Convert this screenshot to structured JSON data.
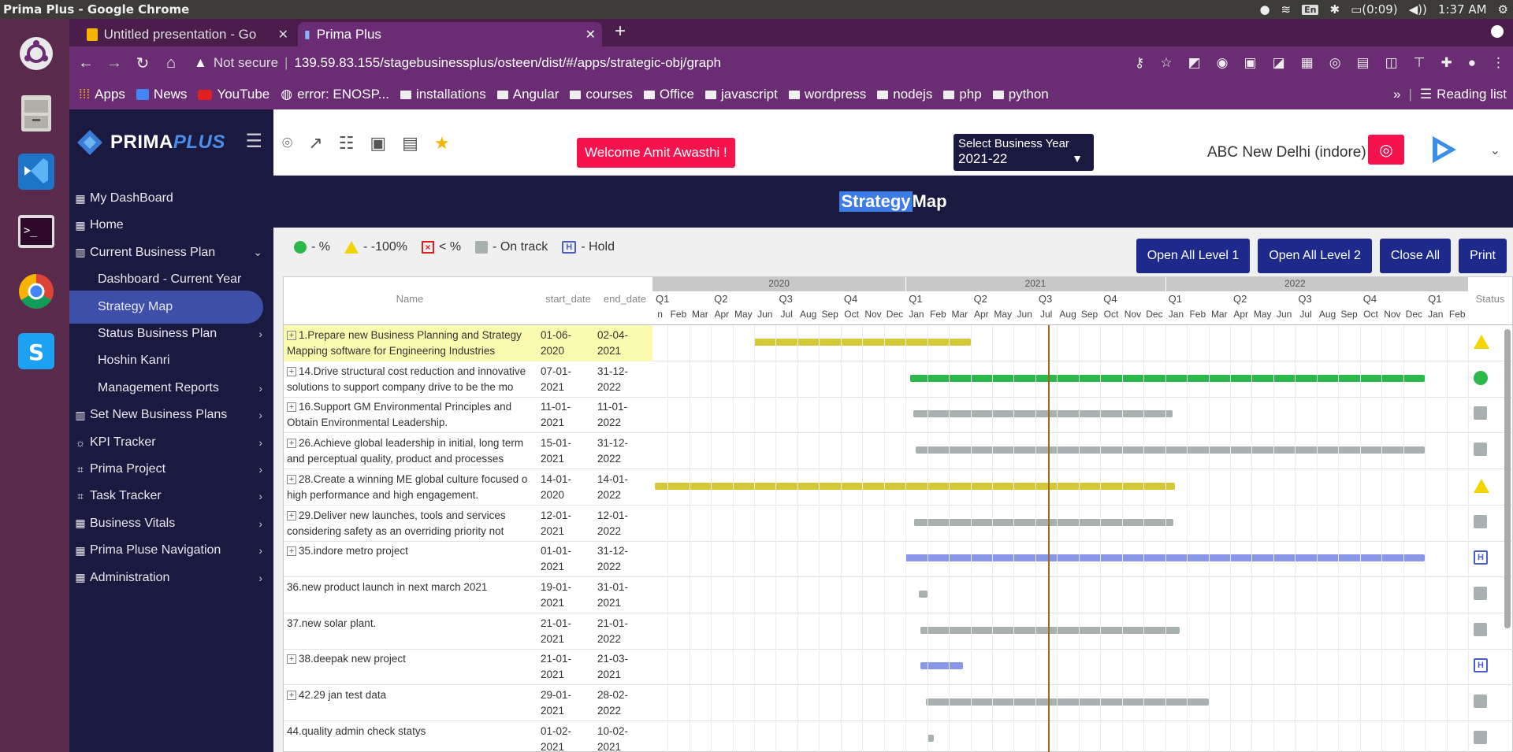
{
  "os": {
    "window_title": "Prima Plus - Google Chrome",
    "battery": "(0:09)",
    "time": "1:37 AM",
    "lang": "En"
  },
  "browser": {
    "tabs": [
      {
        "label": "Untitled presentation - Go",
        "icon": "slides-icon"
      },
      {
        "label": "Prima Plus",
        "icon": "chart-icon"
      }
    ],
    "url_security": "Not secure",
    "url": "139.59.83.155/stagebusinessplus/osteen/dist/#/apps/strategic-obj/graph",
    "bookmarks": [
      "Apps",
      "News",
      "YouTube",
      "error: ENOSP...",
      "installations",
      "Angular",
      "courses",
      "Office",
      "javascript",
      "wordpress",
      "nodejs",
      "php",
      "python"
    ],
    "reading_list": "Reading list",
    "more_bookmarks": "»"
  },
  "header": {
    "brand_main": "PRIMA",
    "brand_plus": "PLUS",
    "welcome": "Welcome  Amit Awasthi !",
    "year_label": "Select Business Year",
    "year_value": "2021-22",
    "org": "ABC New Delhi (indore)"
  },
  "sidebar": {
    "items": [
      {
        "label": "My DashBoard",
        "icon": "dashboard-icon",
        "sub": false,
        "chev": ""
      },
      {
        "label": "Home",
        "icon": "dashboard-icon",
        "sub": false,
        "chev": ""
      },
      {
        "label": "Current Business Plan",
        "icon": "plan-icon",
        "sub": false,
        "chev": "⌄"
      },
      {
        "label": "Dashboard - Current Year",
        "icon": "",
        "sub": true,
        "chev": ""
      },
      {
        "label": "Strategy Map",
        "icon": "",
        "sub": true,
        "chev": "",
        "active": true
      },
      {
        "label": "Status Business Plan",
        "icon": "",
        "sub": true,
        "chev": "›"
      },
      {
        "label": "Hoshin Kanri",
        "icon": "",
        "sub": true,
        "chev": ""
      },
      {
        "label": "Management Reports",
        "icon": "",
        "sub": true,
        "chev": "›"
      },
      {
        "label": "Set New Business Plans",
        "icon": "plan-icon",
        "sub": false,
        "chev": "›"
      },
      {
        "label": "KPI Tracker",
        "icon": "sun-icon",
        "sub": false,
        "chev": "›"
      },
      {
        "label": "Prima Project",
        "icon": "crop-icon",
        "sub": false,
        "chev": "›"
      },
      {
        "label": "Task Tracker",
        "icon": "crop-icon",
        "sub": false,
        "chev": "›"
      },
      {
        "label": "Business Vitals",
        "icon": "grid-icon",
        "sub": false,
        "chev": "›"
      },
      {
        "label": "Prima Pluse Navigation",
        "icon": "grid-icon",
        "sub": false,
        "chev": "›"
      },
      {
        "label": "Administration",
        "icon": "grid-icon",
        "sub": false,
        "chev": "›"
      }
    ]
  },
  "page": {
    "title_hl": "Strategy",
    "title_rest": " Map",
    "legend": [
      {
        "shape": "dot",
        "text": "- %"
      },
      {
        "shape": "tri",
        "text": "- -100%"
      },
      {
        "shape": "x",
        "text": "< %"
      },
      {
        "shape": "sq",
        "text": "- On track"
      },
      {
        "shape": "h",
        "text": "- Hold"
      }
    ],
    "buttons": [
      "Open All Level 1",
      "Open All Level 2",
      "Close All",
      "Print"
    ]
  },
  "gantt": {
    "col_name": "Name",
    "col_start": "start_date",
    "col_end": "end_date",
    "col_status": "Status",
    "years": [
      "2020",
      "2021",
      "2022"
    ],
    "quarters": [
      "Q1",
      "Q2",
      "Q3",
      "Q4",
      "Q1",
      "Q2",
      "Q3",
      "Q4",
      "Q1",
      "Q2",
      "Q3",
      "Q4",
      "Q1"
    ],
    "months": [
      "Feb",
      "Mar",
      "Apr",
      "May",
      "Jun",
      "Jul",
      "Aug",
      "Sep",
      "Oct",
      "Nov",
      "Dec",
      "Jan",
      "Feb",
      "Mar",
      "Apr",
      "May",
      "Jun",
      "Jul",
      "Aug",
      "Sep",
      "Oct",
      "Nov",
      "Dec",
      "Jan",
      "Feb",
      "Mar",
      "Apr",
      "May",
      "Jun",
      "Jul",
      "Aug",
      "Sep",
      "Oct",
      "Nov",
      "Dec",
      "Jan",
      "Feb"
    ],
    "first_month_partial": "n",
    "status_colors": {
      "yellow": "#d4c836",
      "green": "#2db84c",
      "gray": "#a8b0b0",
      "blue": "#8a96e8"
    },
    "rows": [
      {
        "expand": true,
        "name1": "1.Prepare new Business Planning and Strategy",
        "name2": "Mapping software for Engineering Industries",
        "start1": "01-06-",
        "start2": "2020",
        "end1": "02-04-",
        "end2": "2021",
        "status": "tri",
        "color": "yellow",
        "bar_start": 4.0,
        "bar_end": 14.0,
        "highlight": true
      },
      {
        "expand": true,
        "name1": "14.Drive structural cost reduction and innovative",
        "name2": "solutions to support company drive to be the mo",
        "start1": "07-01-",
        "start2": "2021",
        "end1": "31-12-",
        "end2": "2022",
        "status": "dot",
        "color": "green",
        "bar_start": 11.2,
        "bar_end": 35.0
      },
      {
        "expand": true,
        "name1": "16.Support GM Environmental Principles and",
        "name2": "Obtain Environmental Leadership.",
        "start1": "11-01-",
        "start2": "2021",
        "end1": "11-01-",
        "end2": "2022",
        "status": "sq",
        "color": "gray",
        "bar_start": 11.35,
        "bar_end": 23.35
      },
      {
        "expand": true,
        "name1": "26.Achieve global leadership in initial, long term",
        "name2": "and perceptual quality, product and processes",
        "start1": "15-01-",
        "start2": "2021",
        "end1": "31-12-",
        "end2": "2022",
        "status": "sq",
        "color": "gray",
        "bar_start": 11.48,
        "bar_end": 35.0
      },
      {
        "expand": true,
        "name1": "28.Create a winning ME global culture focused o",
        "name2": "high performance and high engagement.",
        "start1": "14-01-",
        "start2": "2020",
        "end1": "14-01-",
        "end2": "2022",
        "status": "tri",
        "color": "yellow",
        "bar_start": -0.6,
        "bar_end": 23.45
      },
      {
        "expand": true,
        "name1": "29.Deliver new launches, tools and services",
        "name2": "considering safety as an overriding priority not",
        "start1": "12-01-",
        "start2": "2021",
        "end1": "12-01-",
        "end2": "2022",
        "status": "sq",
        "color": "gray",
        "bar_start": 11.38,
        "bar_end": 23.38
      },
      {
        "expand": true,
        "name1": "35.indore metro project",
        "name2": "",
        "start1": "01-01-",
        "start2": "2021",
        "end1": "31-12-",
        "end2": "2022",
        "status": "h",
        "color": "blue",
        "bar_start": 11.0,
        "bar_end": 35.0
      },
      {
        "expand": false,
        "name1": "36.new product launch in next march 2021",
        "name2": "",
        "start1": "19-01-",
        "start2": "2021",
        "end1": "31-01-",
        "end2": "2021",
        "status": "sq",
        "color": "gray",
        "bar_start": 11.6,
        "bar_end": 12.0
      },
      {
        "expand": false,
        "name1": "37.new solar plant.",
        "name2": "",
        "start1": "21-01-",
        "start2": "2021",
        "end1": "21-01-",
        "end2": "2022",
        "status": "sq",
        "color": "gray",
        "bar_start": 11.68,
        "bar_end": 23.68
      },
      {
        "expand": true,
        "name1": "38.deepak new project",
        "name2": "",
        "start1": "21-01-",
        "start2": "2021",
        "end1": "21-03-",
        "end2": "2021",
        "status": "h",
        "color": "blue",
        "bar_start": 11.68,
        "bar_end": 13.65
      },
      {
        "expand": true,
        "name1": "42.29 jan test data",
        "name2": "",
        "start1": "29-01-",
        "start2": "2021",
        "end1": "28-02-",
        "end2": "2022",
        "status": "sq",
        "color": "gray",
        "bar_start": 11.93,
        "bar_end": 25.0
      },
      {
        "expand": false,
        "name1": "44.quality admin check statys",
        "name2": "",
        "start1": "01-02-",
        "start2": "2021",
        "end1": "10-02-",
        "end2": "2021",
        "status": "sq",
        "color": "gray",
        "bar_start": 12.0,
        "bar_end": 12.3
      }
    ],
    "today_month": 17.6
  }
}
